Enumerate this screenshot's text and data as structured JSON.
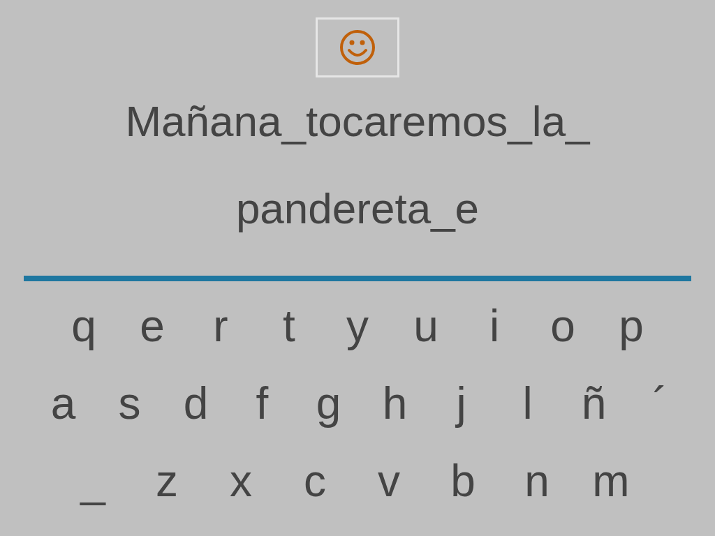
{
  "prompt_lines": [
    "Mañana_tocaremos_la_",
    "pandereta_e"
  ],
  "keyboard_rows": [
    [
      "q",
      "e",
      "r",
      "t",
      "y",
      "u",
      "i",
      "o",
      "p"
    ],
    [
      "a",
      "s",
      "d",
      "f",
      "g",
      "h",
      "j",
      "l",
      "ñ",
      "´"
    ],
    [
      "_",
      "z",
      "x",
      "c",
      "v",
      "b",
      "n",
      "m"
    ]
  ]
}
